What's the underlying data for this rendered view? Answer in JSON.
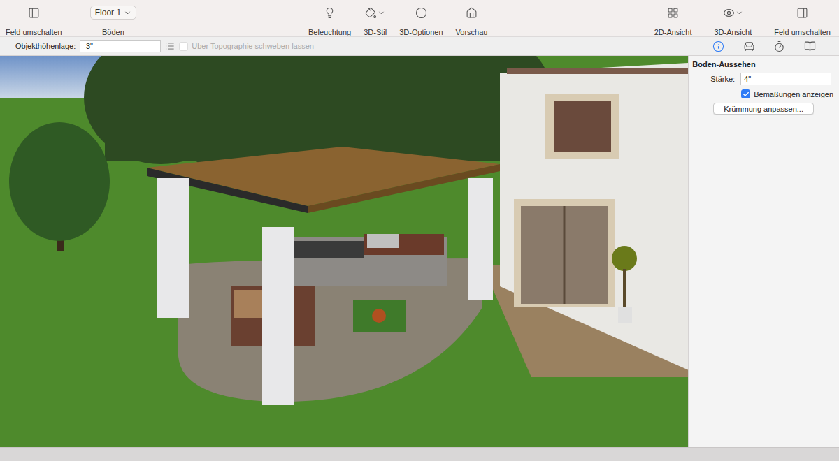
{
  "toolbar": {
    "left": {
      "label": "Feld umschalten"
    },
    "floor": {
      "value": "Floor 1",
      "label": "Böden"
    },
    "center": [
      {
        "icon": "lightbulb",
        "label": "Beleuchtung",
        "dropdown": false
      },
      {
        "icon": "paint-bucket",
        "label": "3D-Stil",
        "dropdown": true
      },
      {
        "icon": "options",
        "label": "3D-Optionen",
        "dropdown": false
      },
      {
        "icon": "house",
        "label": "Vorschau",
        "dropdown": false
      }
    ],
    "right": [
      {
        "icon": "grid",
        "label": "2D-Ansicht",
        "dropdown": false
      },
      {
        "icon": "eye",
        "label": "3D-Ansicht",
        "dropdown": true
      },
      {
        "icon": "panel-right",
        "label": "Feld umschalten",
        "dropdown": false
      }
    ]
  },
  "options_bar": {
    "label": "Objekthöhenlage:",
    "value": "-3\"",
    "checkbox": {
      "label": "Über Topographie schweben lassen",
      "checked": false,
      "disabled": true
    }
  },
  "inspector": {
    "tabs": [
      {
        "icon": "info",
        "selected": true
      },
      {
        "icon": "chair",
        "selected": false
      },
      {
        "icon": "timer",
        "selected": false
      },
      {
        "icon": "book",
        "selected": false
      }
    ],
    "section": "Boden-Aussehen",
    "fields": [
      {
        "label": "Stärke:",
        "value": "4\""
      }
    ],
    "checkbox": {
      "label": "Bemaßungen anzeigen",
      "checked": true
    },
    "button": "Krümmung anpassen..."
  }
}
